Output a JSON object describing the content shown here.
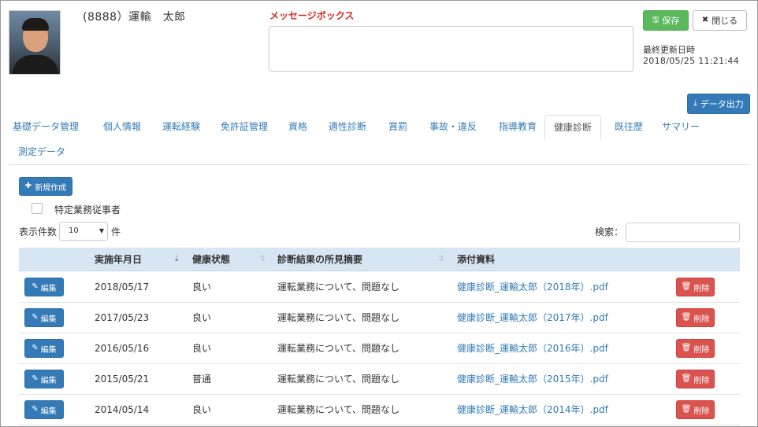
{
  "profile": {
    "name": "(8888）運輸　太郎"
  },
  "message": {
    "label": "メッセージボックス",
    "value": ""
  },
  "actions": {
    "save_icon": "floppy-disk-icon",
    "save_label": "保存",
    "close_icon": "close-x-icon",
    "close_label": "閉じる",
    "export_icon": "download-icon",
    "export_label": "データ出力"
  },
  "last_updated": {
    "label": "最終更新日時",
    "value": "2018/05/25 11:21:44"
  },
  "tabs": [
    {
      "label": "基礎データ管理"
    },
    {
      "label": "個人情報"
    },
    {
      "label": "運転経験"
    },
    {
      "label": "免許証管理"
    },
    {
      "label": "資格"
    },
    {
      "label": "適性診断"
    },
    {
      "label": "賞罰"
    },
    {
      "label": "事故・違反"
    },
    {
      "label": "指導教育"
    },
    {
      "label": "健康診断"
    },
    {
      "label": "既往歴"
    },
    {
      "label": "サマリー"
    },
    {
      "label": "測定データ"
    }
  ],
  "active_tab": "健康診断",
  "toolbar": {
    "new_icon": "plus-icon",
    "new_label": "新規作成",
    "specific_worker_label": "特定業務従事者",
    "specific_worker_checked": false
  },
  "table_controls": {
    "length_label": "表示件数",
    "length_value": "10",
    "length_unit": "件",
    "search_label": "検索：",
    "search_value": ""
  },
  "table": {
    "columns": [
      "実施年月日",
      "健康状態",
      "診断結果の所見摘要",
      "添付資料"
    ],
    "edit_label": "編集",
    "delete_label": "削除",
    "rows": [
      {
        "date": "2018/05/17",
        "status": "良い",
        "summary": "運転業務について、問題なし",
        "attachment": "健康診断_運輸太郎（2018年）.pdf"
      },
      {
        "date": "2017/05/23",
        "status": "良い",
        "summary": "運転業務について、問題なし",
        "attachment": "健康診断_運輸太郎（2017年）.pdf"
      },
      {
        "date": "2016/05/16",
        "status": "良い",
        "summary": "運転業務について、問題なし",
        "attachment": "健康診断_運輸太郎（2016年）.pdf"
      },
      {
        "date": "2015/05/21",
        "status": "普通",
        "summary": "運転業務について、問題なし",
        "attachment": "健康診断_運輸太郎（2015年）.pdf"
      },
      {
        "date": "2014/05/14",
        "status": "良い",
        "summary": "運転業務について、問題なし",
        "attachment": "健康診断_運輸太郎（2014年）.pdf"
      }
    ]
  },
  "colors": {
    "primary": "#337ab7",
    "success": "#5cb85c",
    "danger": "#d9534f",
    "message_label": "#d62b1f",
    "table_header": "#d8e6f3"
  }
}
